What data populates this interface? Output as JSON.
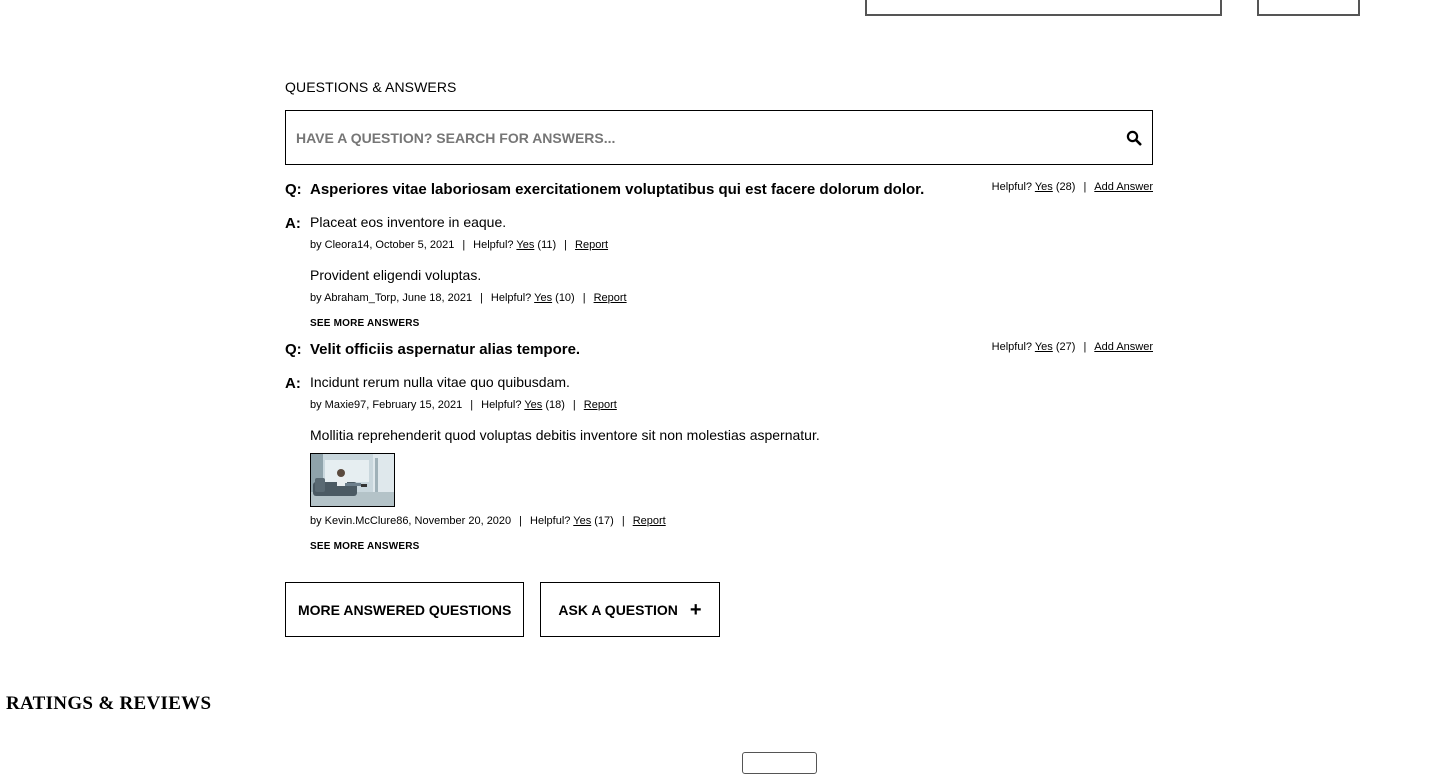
{
  "qa": {
    "title": "QUESTIONS & ANSWERS",
    "search_placeholder": "HAVE A QUESTION? SEARCH FOR ANSWERS...",
    "questions": [
      {
        "prefix": "Q:",
        "text": "Asperiores vitae laboriosam exercitationem voluptatibus qui est facere dolorum dolor.",
        "helpful_label": "Helpful?",
        "yes_label": "Yes",
        "yes_count": "(28)",
        "add_answer": "Add Answer",
        "answer_prefix": "A:",
        "answers": [
          {
            "body": "Placeat eos inventore in eaque.",
            "byline": "by Cleora14, October 5, 2021",
            "helpful_label": "Helpful?",
            "yes_label": "Yes",
            "yes_count": "(11)",
            "report": "Report"
          },
          {
            "body": "Provident eligendi voluptas.",
            "byline": "by Abraham_Torp, June 18, 2021",
            "helpful_label": "Helpful?",
            "yes_label": "Yes",
            "yes_count": "(10)",
            "report": "Report"
          }
        ],
        "see_more": "SEE MORE ANSWERS"
      },
      {
        "prefix": "Q:",
        "text": "Velit officiis aspernatur alias tempore.",
        "helpful_label": "Helpful?",
        "yes_label": "Yes",
        "yes_count": "(27)",
        "add_answer": "Add Answer",
        "answer_prefix": "A:",
        "answers": [
          {
            "body": "Incidunt rerum nulla vitae quo quibusdam.",
            "byline": "by Maxie97, February 15, 2021",
            "helpful_label": "Helpful?",
            "yes_label": "Yes",
            "yes_count": "(18)",
            "report": "Report"
          },
          {
            "body": "Mollitia reprehenderit quod voluptas debitis inventore sit non molestias aspernatur.",
            "byline": "by Kevin.McClure86, November 20, 2020",
            "helpful_label": "Helpful?",
            "yes_label": "Yes",
            "yes_count": "(17)",
            "report": "Report"
          }
        ],
        "see_more": "SEE MORE ANSWERS"
      }
    ],
    "more_button": "MORE ANSWERED QUESTIONS",
    "ask_button": "ASK A QUESTION",
    "ask_icon": "plus-icon",
    "search_icon": "search-icon"
  },
  "reviews": {
    "title": "RATINGS & REVIEWS"
  }
}
